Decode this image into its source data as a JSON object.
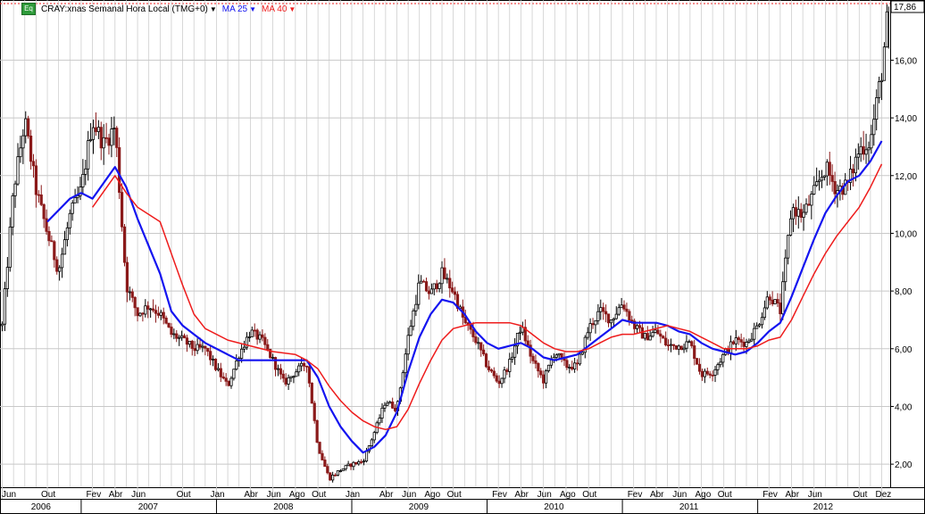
{
  "legend": {
    "icon_text": "Eq",
    "symbol": "CRAY:xnas Semanal Hora Local (TMG+0)",
    "ma_fast_label": "MA 25",
    "ma_slow_label": "MA 40",
    "dropdown_glyph": "▼"
  },
  "colors": {
    "background": "#ffffff",
    "grid": "#c8c8c8",
    "axis": "#000000",
    "candle_up": "#000000",
    "candle_down": "#8b1a1a",
    "ma_fast": "#1414f0",
    "ma_slow": "#ee1c1c",
    "last_price_bg": "#ffffff",
    "legend_text": "#000000"
  },
  "chart_data": {
    "type": "line",
    "title": "CRAY:xnas Semanal Hora Local (TMG+0)",
    "ylim": [
      1.2,
      17.9
    ],
    "yticks": [
      2,
      4,
      6,
      8,
      10,
      12,
      14,
      16
    ],
    "ytick_labels": [
      "2,00",
      "4,00",
      "6,00",
      "8,00",
      "10,00",
      "12,00",
      "14,00",
      "16,00"
    ],
    "last_price": 17.86,
    "last_price_label": "17,86",
    "x_start": "2006-06",
    "x_end": "2012-12",
    "month_labels": [
      {
        "d": "2006-06",
        "t": "Jun"
      },
      {
        "d": "2006-10",
        "t": "Out"
      },
      {
        "d": "2007-02",
        "t": "Fev"
      },
      {
        "d": "2007-04",
        "t": "Abr"
      },
      {
        "d": "2007-06",
        "t": "Jun"
      },
      {
        "d": "2007-10",
        "t": "Out"
      },
      {
        "d": "2008-01",
        "t": "Jan"
      },
      {
        "d": "2008-04",
        "t": "Abr"
      },
      {
        "d": "2008-06",
        "t": "Jun"
      },
      {
        "d": "2008-08",
        "t": "Ago"
      },
      {
        "d": "2008-10",
        "t": "Out"
      },
      {
        "d": "2009-01",
        "t": "Jan"
      },
      {
        "d": "2009-04",
        "t": "Abr"
      },
      {
        "d": "2009-06",
        "t": "Jun"
      },
      {
        "d": "2009-08",
        "t": "Ago"
      },
      {
        "d": "2009-10",
        "t": "Out"
      },
      {
        "d": "2010-02",
        "t": "Fev"
      },
      {
        "d": "2010-04",
        "t": "Abr"
      },
      {
        "d": "2010-06",
        "t": "Jun"
      },
      {
        "d": "2010-08",
        "t": "Ago"
      },
      {
        "d": "2010-10",
        "t": "Out"
      },
      {
        "d": "2011-02",
        "t": "Fev"
      },
      {
        "d": "2011-04",
        "t": "Abr"
      },
      {
        "d": "2011-06",
        "t": "Jun"
      },
      {
        "d": "2011-08",
        "t": "Ago"
      },
      {
        "d": "2011-10",
        "t": "Out"
      },
      {
        "d": "2012-02",
        "t": "Fev"
      },
      {
        "d": "2012-04",
        "t": "Abr"
      },
      {
        "d": "2012-06",
        "t": "Jun"
      },
      {
        "d": "2012-10",
        "t": "Out"
      },
      {
        "d": "2012-12",
        "t": "Dez"
      }
    ],
    "year_labels": [
      {
        "d": "2006-06",
        "t": "2006"
      },
      {
        "d": "2007-01",
        "t": "2007"
      },
      {
        "d": "2008-01",
        "t": "2008"
      },
      {
        "d": "2009-01",
        "t": "2009"
      },
      {
        "d": "2010-01",
        "t": "2010"
      },
      {
        "d": "2011-01",
        "t": "2011"
      },
      {
        "d": "2012-01",
        "t": "2012"
      }
    ],
    "series": [
      {
        "name": "CRAY:xnas",
        "kind": "price",
        "points": [
          [
            "2006-06",
            6.8
          ],
          [
            "2006-07",
            11.5
          ],
          [
            "2006-08",
            13.9
          ],
          [
            "2006-09",
            11.5
          ],
          [
            "2006-10",
            10.0
          ],
          [
            "2006-11",
            8.7
          ],
          [
            "2006-12",
            10.6
          ],
          [
            "2007-01",
            11.5
          ],
          [
            "2007-02",
            13.9
          ],
          [
            "2007-03",
            13.1
          ],
          [
            "2007-04",
            13.7
          ],
          [
            "2007-05",
            8.2
          ],
          [
            "2007-06",
            7.2
          ],
          [
            "2007-07",
            7.5
          ],
          [
            "2007-08",
            7.2
          ],
          [
            "2007-09",
            6.5
          ],
          [
            "2007-10",
            6.3
          ],
          [
            "2007-11",
            6.0
          ],
          [
            "2007-12",
            6.0
          ],
          [
            "2008-01",
            5.3
          ],
          [
            "2008-02",
            4.7
          ],
          [
            "2008-03",
            5.8
          ],
          [
            "2008-04",
            6.6
          ],
          [
            "2008-05",
            6.3
          ],
          [
            "2008-06",
            5.6
          ],
          [
            "2008-07",
            4.8
          ],
          [
            "2008-08",
            5.2
          ],
          [
            "2008-09",
            5.5
          ],
          [
            "2008-10",
            2.6
          ],
          [
            "2008-11",
            1.5
          ],
          [
            "2008-12",
            1.8
          ],
          [
            "2009-01",
            2.0
          ],
          [
            "2009-02",
            2.1
          ],
          [
            "2009-03",
            3.1
          ],
          [
            "2009-04",
            4.2
          ],
          [
            "2009-05",
            3.9
          ],
          [
            "2009-06",
            6.4
          ],
          [
            "2009-07",
            8.3
          ],
          [
            "2009-08",
            7.9
          ],
          [
            "2009-09",
            8.6
          ],
          [
            "2009-10",
            8.0
          ],
          [
            "2009-11",
            6.9
          ],
          [
            "2009-12",
            6.3
          ],
          [
            "2010-01",
            5.4
          ],
          [
            "2010-02",
            4.8
          ],
          [
            "2010-03",
            5.5
          ],
          [
            "2010-04",
            6.8
          ],
          [
            "2010-05",
            5.6
          ],
          [
            "2010-06",
            4.9
          ],
          [
            "2010-07",
            5.9
          ],
          [
            "2010-08",
            5.4
          ],
          [
            "2010-09",
            5.4
          ],
          [
            "2010-10",
            6.7
          ],
          [
            "2010-11",
            7.3
          ],
          [
            "2010-12",
            7.0
          ],
          [
            "2011-01",
            7.6
          ],
          [
            "2011-02",
            6.8
          ],
          [
            "2011-03",
            6.4
          ],
          [
            "2011-04",
            6.6
          ],
          [
            "2011-05",
            6.1
          ],
          [
            "2011-06",
            6.1
          ],
          [
            "2011-07",
            6.2
          ],
          [
            "2011-08",
            5.1
          ],
          [
            "2011-09",
            5.2
          ],
          [
            "2011-10",
            5.8
          ],
          [
            "2011-11",
            6.3
          ],
          [
            "2011-12",
            6.2
          ],
          [
            "2012-01",
            6.8
          ],
          [
            "2012-02",
            7.9
          ],
          [
            "2012-03",
            7.3
          ],
          [
            "2012-04",
            10.9
          ],
          [
            "2012-05",
            10.6
          ],
          [
            "2012-06",
            11.4
          ],
          [
            "2012-07",
            12.3
          ],
          [
            "2012-08",
            11.5
          ],
          [
            "2012-09",
            11.7
          ],
          [
            "2012-10",
            12.9
          ],
          [
            "2012-11",
            13.2
          ],
          [
            "2012-12",
            15.6
          ],
          [
            "2012-12-20",
            17.86
          ]
        ]
      },
      {
        "name": "MA 25",
        "kind": "ma_fast",
        "points": [
          [
            "2006-10",
            10.4
          ],
          [
            "2006-12",
            11.2
          ],
          [
            "2007-01",
            11.4
          ],
          [
            "2007-02",
            11.2
          ],
          [
            "2007-04",
            12.3
          ],
          [
            "2007-05",
            11.6
          ],
          [
            "2007-06",
            10.5
          ],
          [
            "2007-08",
            8.6
          ],
          [
            "2007-09",
            7.3
          ],
          [
            "2007-10",
            6.8
          ],
          [
            "2007-11",
            6.5
          ],
          [
            "2007-12",
            6.2
          ],
          [
            "2008-02",
            5.8
          ],
          [
            "2008-03",
            5.6
          ],
          [
            "2008-05",
            5.6
          ],
          [
            "2008-07",
            5.6
          ],
          [
            "2008-09",
            5.6
          ],
          [
            "2008-10",
            5.0
          ],
          [
            "2008-11",
            4.0
          ],
          [
            "2008-12",
            3.3
          ],
          [
            "2009-01",
            2.8
          ],
          [
            "2009-02",
            2.4
          ],
          [
            "2009-03",
            2.6
          ],
          [
            "2009-04",
            3.0
          ],
          [
            "2009-05",
            3.8
          ],
          [
            "2009-06",
            5.2
          ],
          [
            "2009-07",
            6.4
          ],
          [
            "2009-08",
            7.2
          ],
          [
            "2009-09",
            7.7
          ],
          [
            "2009-10",
            7.6
          ],
          [
            "2009-11",
            7.2
          ],
          [
            "2009-12",
            6.6
          ],
          [
            "2010-01",
            6.2
          ],
          [
            "2010-02",
            6.0
          ],
          [
            "2010-03",
            6.1
          ],
          [
            "2010-04",
            6.2
          ],
          [
            "2010-05",
            6.0
          ],
          [
            "2010-06",
            5.7
          ],
          [
            "2010-07",
            5.6
          ],
          [
            "2010-08",
            5.7
          ],
          [
            "2010-09",
            5.8
          ],
          [
            "2010-10",
            6.1
          ],
          [
            "2010-11",
            6.4
          ],
          [
            "2010-12",
            6.7
          ],
          [
            "2011-01",
            7.0
          ],
          [
            "2011-02",
            6.9
          ],
          [
            "2011-03",
            6.9
          ],
          [
            "2011-04",
            6.9
          ],
          [
            "2011-05",
            6.8
          ],
          [
            "2011-06",
            6.6
          ],
          [
            "2011-07",
            6.5
          ],
          [
            "2011-08",
            6.2
          ],
          [
            "2011-09",
            6.0
          ],
          [
            "2011-10",
            5.9
          ],
          [
            "2011-11",
            5.8
          ],
          [
            "2011-12",
            5.9
          ],
          [
            "2012-01",
            6.2
          ],
          [
            "2012-02",
            6.6
          ],
          [
            "2012-03",
            6.9
          ],
          [
            "2012-04",
            7.8
          ],
          [
            "2012-05",
            8.8
          ],
          [
            "2012-06",
            9.8
          ],
          [
            "2012-07",
            10.7
          ],
          [
            "2012-08",
            11.3
          ],
          [
            "2012-09",
            11.8
          ],
          [
            "2012-10",
            12.0
          ],
          [
            "2012-11",
            12.5
          ],
          [
            "2012-12",
            13.2
          ]
        ]
      },
      {
        "name": "MA 40",
        "kind": "ma_slow",
        "points": [
          [
            "2007-02",
            10.9
          ],
          [
            "2007-04",
            12.0
          ],
          [
            "2007-05",
            11.4
          ],
          [
            "2007-06",
            10.9
          ],
          [
            "2007-08",
            10.4
          ],
          [
            "2007-09",
            9.3
          ],
          [
            "2007-10",
            8.2
          ],
          [
            "2007-11",
            7.2
          ],
          [
            "2007-12",
            6.7
          ],
          [
            "2008-02",
            6.3
          ],
          [
            "2008-04",
            6.1
          ],
          [
            "2008-06",
            5.9
          ],
          [
            "2008-08",
            5.8
          ],
          [
            "2008-09",
            5.6
          ],
          [
            "2008-10",
            5.3
          ],
          [
            "2008-11",
            4.7
          ],
          [
            "2008-12",
            4.2
          ],
          [
            "2009-01",
            3.8
          ],
          [
            "2009-02",
            3.5
          ],
          [
            "2009-03",
            3.3
          ],
          [
            "2009-04",
            3.2
          ],
          [
            "2009-05",
            3.3
          ],
          [
            "2009-06",
            3.9
          ],
          [
            "2009-07",
            4.8
          ],
          [
            "2009-08",
            5.6
          ],
          [
            "2009-09",
            6.3
          ],
          [
            "2009-10",
            6.7
          ],
          [
            "2009-11",
            6.8
          ],
          [
            "2009-12",
            6.9
          ],
          [
            "2010-01",
            6.9
          ],
          [
            "2010-02",
            6.9
          ],
          [
            "2010-03",
            6.9
          ],
          [
            "2010-04",
            6.8
          ],
          [
            "2010-05",
            6.5
          ],
          [
            "2010-06",
            6.2
          ],
          [
            "2010-07",
            6.0
          ],
          [
            "2010-08",
            5.9
          ],
          [
            "2010-09",
            5.9
          ],
          [
            "2010-10",
            6.0
          ],
          [
            "2010-11",
            6.2
          ],
          [
            "2010-12",
            6.4
          ],
          [
            "2011-01",
            6.5
          ],
          [
            "2011-02",
            6.5
          ],
          [
            "2011-03",
            6.6
          ],
          [
            "2011-04",
            6.7
          ],
          [
            "2011-05",
            6.8
          ],
          [
            "2011-06",
            6.7
          ],
          [
            "2011-07",
            6.6
          ],
          [
            "2011-08",
            6.4
          ],
          [
            "2011-09",
            6.2
          ],
          [
            "2011-10",
            6.0
          ],
          [
            "2011-11",
            6.0
          ],
          [
            "2011-12",
            6.0
          ],
          [
            "2012-01",
            6.1
          ],
          [
            "2012-02",
            6.3
          ],
          [
            "2012-03",
            6.4
          ],
          [
            "2012-04",
            7.0
          ],
          [
            "2012-05",
            7.8
          ],
          [
            "2012-06",
            8.6
          ],
          [
            "2012-07",
            9.3
          ],
          [
            "2012-08",
            9.9
          ],
          [
            "2012-09",
            10.4
          ],
          [
            "2012-10",
            10.9
          ],
          [
            "2012-11",
            11.6
          ],
          [
            "2012-12",
            12.4
          ]
        ]
      }
    ]
  }
}
